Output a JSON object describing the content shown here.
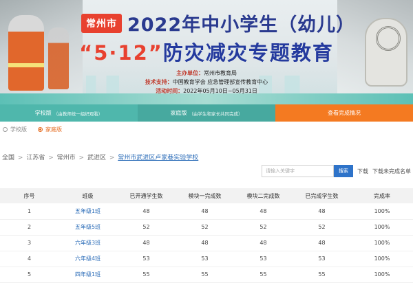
{
  "banner": {
    "city_tag": "常州市",
    "title": "2022年中小学生（幼儿）",
    "subtitle_quote": "“5·12”",
    "subtitle_rest": "防灾减灾专题教育",
    "organizer_label": "主办单位：",
    "organizer": "常州市教育局",
    "support_label": "技术支持：",
    "support": "中国教育学会 应急管理部宣传教育中心",
    "time_label": "活动时间：",
    "time": "2022年05月10日~05月31日"
  },
  "nav": {
    "school": {
      "label": "学校版",
      "sub": "（由教师统一组织观看）"
    },
    "family": {
      "label": "家庭版",
      "sub": "（由学生和家长共同完成）"
    },
    "status": {
      "label": "查看完成情况"
    }
  },
  "radios": {
    "school": "学校版",
    "family": "家庭版"
  },
  "breadcrumb": {
    "items": [
      "全国",
      "江苏省",
      "常州市",
      "武进区"
    ],
    "current": "常州市武进区卢家巷实验学校",
    "separator": ">"
  },
  "search": {
    "placeholder": "请输入关键字",
    "button": "搜索",
    "download": "下载",
    "download_unfinished": "下载未完成名单"
  },
  "table": {
    "headers": [
      "序号",
      "班级",
      "已开通学生数",
      "模块一完成数",
      "模块二完成数",
      "已完成学生数",
      "完成率"
    ],
    "rows": [
      [
        "1",
        "五年级1班",
        "48",
        "48",
        "48",
        "48",
        "100%"
      ],
      [
        "2",
        "五年级5班",
        "52",
        "52",
        "52",
        "52",
        "100%"
      ],
      [
        "3",
        "六年级3班",
        "48",
        "48",
        "48",
        "48",
        "100%"
      ],
      [
        "4",
        "六年级4班",
        "53",
        "53",
        "53",
        "53",
        "100%"
      ],
      [
        "5",
        "四年级1班",
        "55",
        "55",
        "55",
        "55",
        "100%"
      ]
    ]
  },
  "colors": {
    "nav_green": "#4fb7ac",
    "nav_orange": "#f47a21",
    "link_blue": "#2b6cb8",
    "search_blue": "#2e73c9",
    "city_tag_red": "#e8412f"
  }
}
